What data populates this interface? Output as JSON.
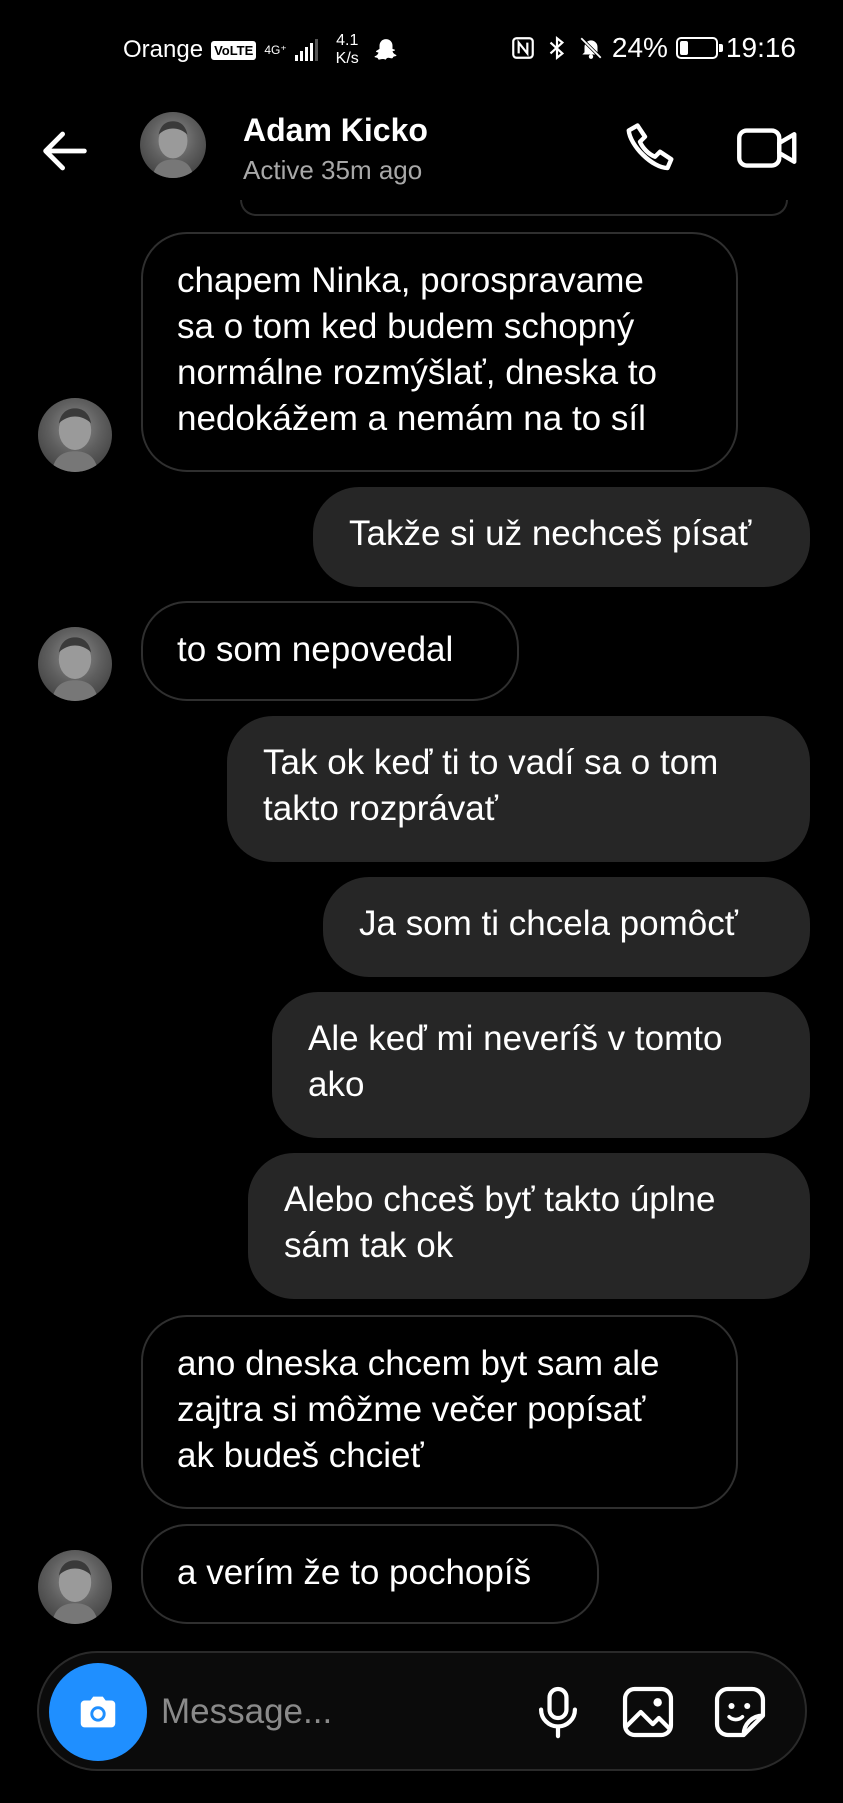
{
  "status_bar": {
    "carrier": "Orange",
    "volte": "VoLTE",
    "network": "4G⁺",
    "speed_value": "4.1",
    "speed_unit": "K/s",
    "battery": "24%",
    "battery_level": 0.24,
    "time": "19:16"
  },
  "header": {
    "contact_name": "Adam Kicko",
    "contact_status": "Active 35m ago"
  },
  "messages": [
    {
      "direction": "incoming",
      "text": "chapem Ninka, porospravame\nsa o tom ked budem schopný\nnormálne rozmýšlať, dneska to\nnedokážem a nemám na to síl"
    },
    {
      "direction": "outgoing",
      "text": "Takže si už nechceš písať"
    },
    {
      "direction": "incoming",
      "text": "to som nepovedal"
    },
    {
      "direction": "outgoing",
      "text": "Tak ok keď ti to vadí sa o tom\ntakto rozprávať"
    },
    {
      "direction": "outgoing",
      "text": "Ja som ti chcela pomôcť"
    },
    {
      "direction": "outgoing",
      "text": "Ale keď mi neveríš v tomto\nako"
    },
    {
      "direction": "outgoing",
      "text": "Alebo chceš byť takto úplne\nsám tak ok"
    },
    {
      "direction": "incoming",
      "text": "ano dneska chcem byt sam ale\nzajtra si môžme večer popísať\nak budeš chcieť"
    },
    {
      "direction": "incoming",
      "text": "a verím že to pochopíš"
    }
  ],
  "composer": {
    "placeholder": "Message..."
  },
  "icons": {
    "back": "arrow-left-icon",
    "call": "phone-icon",
    "video": "video-camera-icon",
    "camera": "camera-icon",
    "mic": "microphone-icon",
    "gallery": "image-icon",
    "sticker": "sticker-icon"
  },
  "colors": {
    "background": "#000000",
    "outgoing_bubble": "#262626",
    "incoming_border": "#2f2f2f",
    "camera_button": "#1f8fff",
    "secondary_text": "#a8a8a8"
  }
}
